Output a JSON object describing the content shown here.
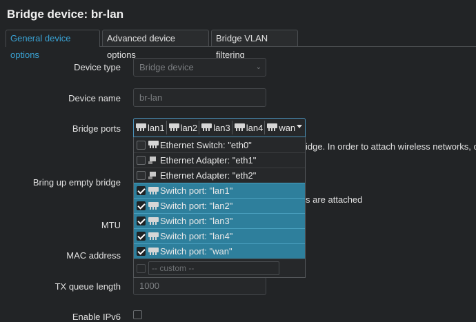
{
  "page": {
    "title": "Bridge device: br-lan"
  },
  "tabs": [
    {
      "label": "General device options"
    },
    {
      "label": "Advanced device options"
    },
    {
      "label": "Bridge VLAN filtering"
    }
  ],
  "form": {
    "device_type": {
      "label": "Device type",
      "value": "Bridge device"
    },
    "device_name": {
      "label": "Device name",
      "value": "br-lan"
    },
    "bridge_ports": {
      "label": "Bridge ports",
      "chips": [
        "lan1",
        "lan2",
        "lan3",
        "lan4",
        "wan"
      ]
    },
    "bring_up": {
      "label": "Bring up empty bridge"
    },
    "mtu": {
      "label": "MTU"
    },
    "mac": {
      "label": "MAC address"
    },
    "txqueue": {
      "label": "TX queue length",
      "placeholder": "1000"
    },
    "ipv6": {
      "label": "Enable IPv6"
    }
  },
  "dropdown": {
    "options": [
      {
        "label": "Ethernet Switch: \"eth0\"",
        "checked": false,
        "icon": "switch-port-icon"
      },
      {
        "label": "Ethernet Adapter: \"eth1\"",
        "checked": false,
        "icon": "ethernet-adapter-icon"
      },
      {
        "label": "Ethernet Adapter: \"eth2\"",
        "checked": false,
        "icon": "ethernet-adapter-icon"
      },
      {
        "label": "Switch port: \"lan1\"",
        "checked": true,
        "icon": "switch-port-icon"
      },
      {
        "label": "Switch port: \"lan2\"",
        "checked": true,
        "icon": "switch-port-icon"
      },
      {
        "label": "Switch port: \"lan3\"",
        "checked": true,
        "icon": "switch-port-icon"
      },
      {
        "label": "Switch port: \"lan4\"",
        "checked": true,
        "icon": "switch-port-icon"
      },
      {
        "label": "Switch port: \"wan\"",
        "checked": true,
        "icon": "switch-port-icon"
      }
    ],
    "custom_placeholder": "-- custom --"
  },
  "obscured": {
    "ports_help": "idge. In order to attach wireless networks, cho",
    "bring_up_help": "s are attached"
  },
  "colors": {
    "accent": "#3aa3d5",
    "selected_row": "#2e7f9c",
    "background": "#222426"
  }
}
